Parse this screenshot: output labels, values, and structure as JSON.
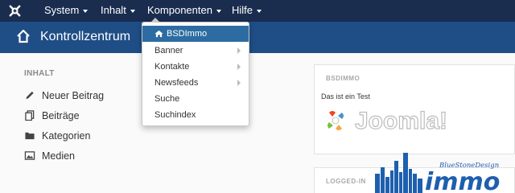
{
  "navbar": {
    "logo_icon": "joomla-logo-icon",
    "menus": [
      "System",
      "Inhalt",
      "Komponenten",
      "Hilfe"
    ]
  },
  "titlebar": {
    "title": "Kontrollzentrum",
    "icon": "home-icon"
  },
  "sidebar": {
    "heading": "INHALT",
    "items": [
      {
        "label": "Neuer Beitrag",
        "icon": "pencil-icon"
      },
      {
        "label": "Beiträge",
        "icon": "copy-icon"
      },
      {
        "label": "Kategorien",
        "icon": "folder-icon"
      },
      {
        "label": "Medien",
        "icon": "image-icon"
      }
    ]
  },
  "dropdown": {
    "items": [
      {
        "label": "BSDImmo",
        "icon": "home-icon",
        "highlighted": true
      },
      {
        "label": "Banner",
        "submenu": true
      },
      {
        "label": "Kontakte",
        "submenu": true
      },
      {
        "label": "Newsfeeds",
        "submenu": true
      },
      {
        "label": "Suche"
      },
      {
        "label": "Suchindex"
      }
    ]
  },
  "modules": {
    "first": {
      "heading": "BSDIMMO",
      "text": "Das ist ein Test",
      "logo_text": "Joomla!"
    },
    "second": {
      "heading": "LOGGED-IN"
    }
  },
  "watermark": {
    "top": "BlueStoneDesign",
    "bottom": "immo"
  },
  "colors": {
    "navbar": "#1a2d4f",
    "titlebar": "#1f4e86",
    "highlight": "#2d6ca2",
    "watermark": "#1e5fae"
  }
}
